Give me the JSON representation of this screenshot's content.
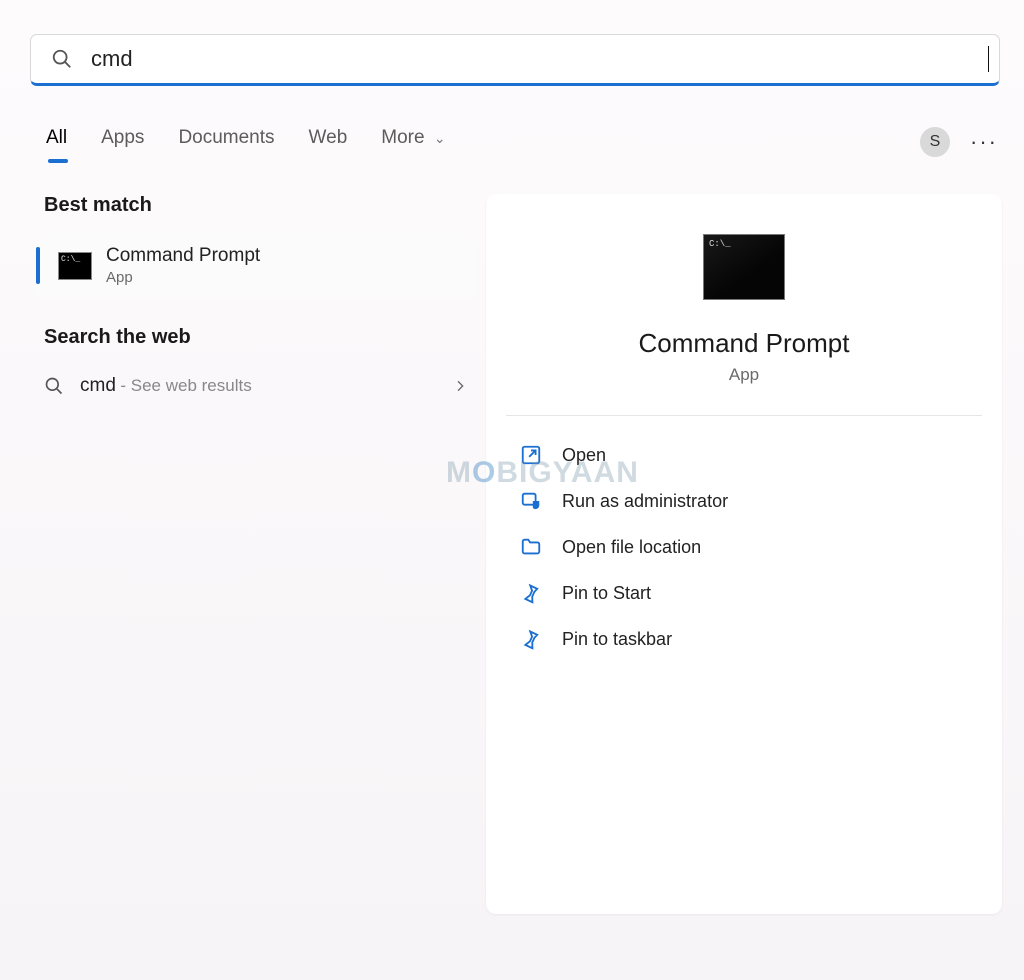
{
  "search": {
    "query": "cmd"
  },
  "tabs": {
    "all": "All",
    "apps": "Apps",
    "documents": "Documents",
    "web": "Web",
    "more": "More"
  },
  "avatar_initial": "S",
  "sections": {
    "best_match": "Best match",
    "search_web": "Search the web"
  },
  "best_match": {
    "title": "Command Prompt",
    "subtitle": "App"
  },
  "web_result": {
    "query": "cmd",
    "hint": "- See web results"
  },
  "preview": {
    "title": "Command Prompt",
    "subtitle": "App",
    "actions": {
      "open": "Open",
      "run_admin": "Run as administrator",
      "open_loc": "Open file location",
      "pin_start": "Pin to Start",
      "pin_taskbar": "Pin to taskbar"
    }
  },
  "watermark": "MOBIGYAAN"
}
